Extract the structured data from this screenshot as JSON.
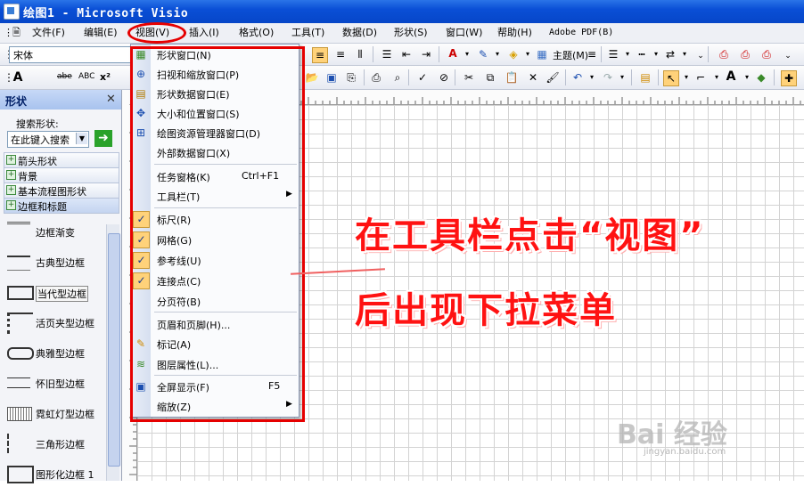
{
  "window": {
    "title": "绘图1 - Microsoft Visio",
    "app_icon": "visio-app-icon"
  },
  "menubar": {
    "items": [
      {
        "label": "文件(F)"
      },
      {
        "label": "编辑(E)"
      },
      {
        "label": "视图(V)"
      },
      {
        "label": "插入(I)"
      },
      {
        "label": "格式(O)"
      },
      {
        "label": "工具(T)"
      },
      {
        "label": "数据(D)"
      },
      {
        "label": "形状(S)"
      },
      {
        "label": "窗口(W)"
      },
      {
        "label": "帮助(H)"
      },
      {
        "label": "Adobe PDF(B)"
      }
    ]
  },
  "toolbar1": {
    "font_name": "宋体",
    "theme_label": "主题(M)"
  },
  "toolbar2": {
    "strike_label": "abe",
    "abc_label": "ABC",
    "sup_label": "x²",
    "sub_label": "x₂"
  },
  "shapes_panel": {
    "title": "形状",
    "search_label": "搜索形状:",
    "search_placeholder": "在此键入搜索",
    "stencils": [
      "箭头形状",
      "背景",
      "基本流程图形状",
      "边框和标题"
    ],
    "shapes": [
      "边框渐变",
      "古典型边框",
      "当代型边框",
      "活页夹型边框",
      "典雅型边框",
      "怀旧型边框",
      "霓虹灯型边框",
      "三角形边框",
      "图形化边框 1"
    ]
  },
  "view_menu": {
    "items": [
      {
        "label": "形状窗口(N)",
        "icon": "shapes-window-icon"
      },
      {
        "label": "扫视和缩放窗口(P)",
        "icon": "pan-zoom-icon"
      },
      {
        "label": "形状数据窗口(E)",
        "icon": "shape-data-icon"
      },
      {
        "label": "大小和位置窗口(S)",
        "icon": "size-position-icon"
      },
      {
        "label": "绘图资源管理器窗口(D)",
        "icon": "drawing-explorer-icon"
      },
      {
        "label": "外部数据窗口(X)",
        "icon": ""
      },
      {
        "label": "任务窗格(K)",
        "shortcut": "Ctrl+F1"
      },
      {
        "label": "工具栏(T)",
        "submenu": true
      },
      {
        "label": "标尺(R)",
        "checked": true
      },
      {
        "label": "网格(G)",
        "checked": true
      },
      {
        "label": "参考线(U)",
        "checked": true
      },
      {
        "label": "连接点(C)",
        "checked": true
      },
      {
        "label": "分页符(B)"
      },
      {
        "label": "页眉和页脚(H)..."
      },
      {
        "label": "标记(A)",
        "icon": "markup-icon"
      },
      {
        "label": "图层属性(L)...",
        "icon": "layer-properties-icon"
      },
      {
        "label": "全屏显示(F)",
        "shortcut": "F5",
        "icon": "full-screen-icon"
      },
      {
        "label": "缩放(Z)",
        "submenu": true
      }
    ]
  },
  "annotation": {
    "line1": "在工具栏点击“视图”",
    "line2": "后出现下拉菜单"
  },
  "watermark": {
    "text": "Bai 经验",
    "sub": "jingyan.baidu.com"
  },
  "colors": {
    "highlight": "#e60000",
    "title_bar": "#0a4fd6",
    "check_bg": "#ffd27a"
  }
}
